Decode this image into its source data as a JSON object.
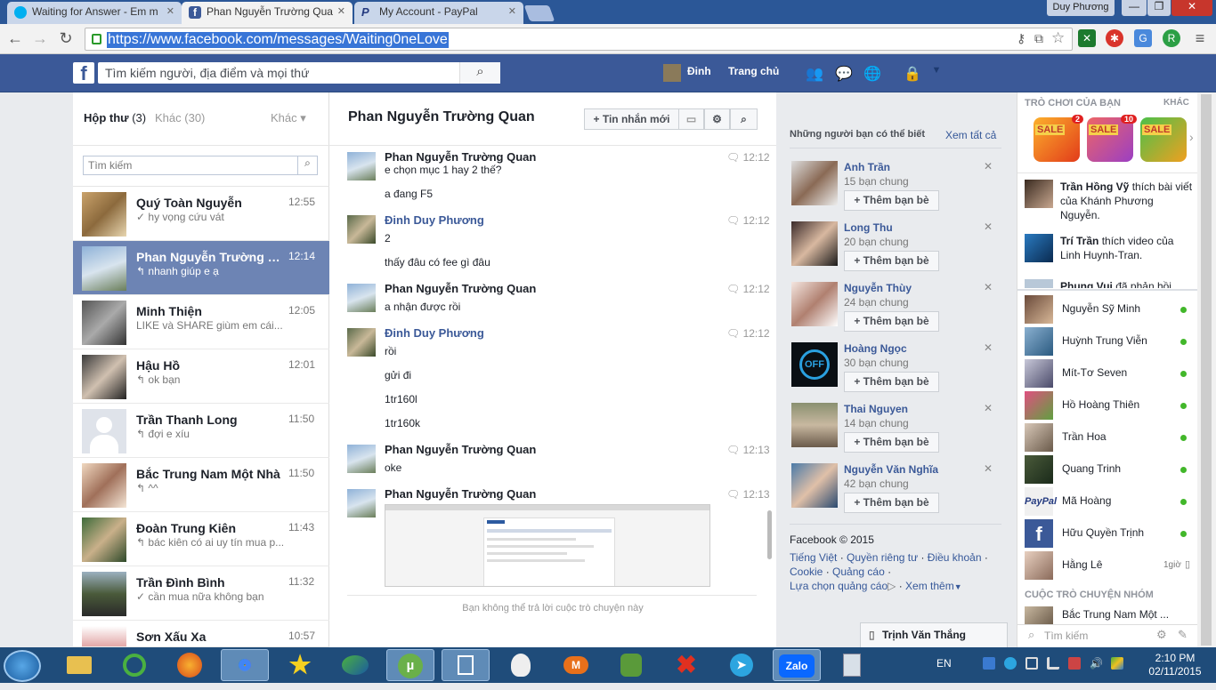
{
  "browser": {
    "tabs": [
      {
        "title": "Waiting for Answer - Em m",
        "icon": "skype-icon"
      },
      {
        "title": "Phan Nguyễn Trường Qua",
        "icon": "facebook-icon"
      },
      {
        "title": "My Account - PayPal",
        "icon": "paypal-icon"
      }
    ],
    "profile_name": "Duy Phương",
    "url": "https://www.facebook.com/messages/Waiting0neLove"
  },
  "fb_header": {
    "search_placeholder": "Tìm kiếm người, địa điểm và mọi thứ",
    "user_name": "Đinh",
    "home_label": "Trang chủ"
  },
  "inbox": {
    "inbox_label": "Hộp thư",
    "inbox_count": "(3)",
    "other_label": "Khác",
    "other_count": "(30)",
    "more_label": "Khác",
    "search_placeholder": "Tìm kiếm",
    "threads": [
      {
        "name": "Quý Toàn Nguyễn",
        "time": "12:55",
        "snippet": "✓ hy vọng cứu vát"
      },
      {
        "name": "Phan Nguyễn Trường Quan",
        "time": "12:14",
        "snippet": "↰ nhanh giúp e ạ"
      },
      {
        "name": "Minh Thiện",
        "time": "12:05",
        "snippet": "LIKE và SHARE giùm em cái..."
      },
      {
        "name": "Hậu Hồ",
        "time": "12:01",
        "snippet": "↰ ok bạn"
      },
      {
        "name": "Trần Thanh Long",
        "time": "11:50",
        "snippet": "↰ đợi e xíu"
      },
      {
        "name": "Bắc Trung Nam Một Nhà",
        "time": "11:50",
        "snippet": "↰ ^^"
      },
      {
        "name": "Đoàn Trung Kiên",
        "time": "11:43",
        "snippet": "↰ bác kiên có ai uy tín mua p..."
      },
      {
        "name": "Trần Đình Bình",
        "time": "11:32",
        "snippet": "✓ cần mua nữa không bạn"
      },
      {
        "name": "Sơn Xấu Xa",
        "time": "10:57",
        "snippet": ""
      }
    ]
  },
  "conversation": {
    "title": "Phan Nguyễn Trường Quan",
    "new_message_label": "Tin nhắn mới",
    "messages": [
      {
        "author": "Phan Nguyễn Trường Quan",
        "time": "12:12",
        "lines": [
          "e chọn mục 1  hay 2 thế?",
          "a đang F5"
        ]
      },
      {
        "author": "Đinh Duy Phương",
        "time": "12:12",
        "lines": [
          "2",
          "thấy đâu có fee gì đâu"
        ]
      },
      {
        "author": "Phan Nguyễn Trường Quan",
        "time": "12:12",
        "lines": [
          "a nhận được rồi"
        ]
      },
      {
        "author": "Đinh Duy Phương",
        "time": "12:12",
        "lines": [
          "rồi",
          "gửi đi",
          "1tr160l",
          "1tr160k"
        ]
      },
      {
        "author": "Phan Nguyễn Trường Quan",
        "time": "12:13",
        "lines": [
          "oke"
        ]
      },
      {
        "author": "Phan Nguyễn Trường Quan",
        "time": "12:13",
        "lines": []
      }
    ],
    "cannot_reply": "Bạn không thể trả lời cuộc trò chuyện này"
  },
  "suggestions": {
    "title": "Những người bạn có thể biết",
    "see_all": "Xem tất cả",
    "add_label": "Thêm bạn bè",
    "people": [
      {
        "name": "Anh Trần",
        "mutual": "15 bạn chung"
      },
      {
        "name": "Long Thu",
        "mutual": "20 bạn chung"
      },
      {
        "name": "Nguyễn Thùy",
        "mutual": "24 bạn chung"
      },
      {
        "name": "Hoàng Ngọc",
        "mutual": "30 bạn chung"
      },
      {
        "name": "Thai Nguyen",
        "mutual": "14 bạn chung"
      },
      {
        "name": "Nguyễn Văn Nghĩa",
        "mutual": "42 bạn chung"
      }
    ],
    "footer": {
      "copyright": "Facebook © 2015",
      "links_1": [
        "Tiếng Việt",
        "Quyền riêng tư",
        "Điều khoản"
      ],
      "links_2": [
        "Cookie",
        "Quảng cáo"
      ],
      "links_3": [
        "Lựa chọn quảng cáo",
        "Xem thêm"
      ]
    }
  },
  "right_sidebar": {
    "games_title": "TRÒ CHƠI CỦA BẠN",
    "games_more": "KHÁC",
    "games": [
      {
        "label": "SALE",
        "badge": "2"
      },
      {
        "label": "SALE",
        "badge": "10"
      },
      {
        "label": "SALE",
        "badge": ""
      }
    ],
    "ticker": [
      {
        "name": "Trần Hồng Vỹ",
        "text": "thích bài viết của Khánh Phương Nguyễn."
      },
      {
        "name": "Trí Trần",
        "text": "thích video của Linh Huynh-Tran."
      },
      {
        "name": "Phung Vui",
        "text": "đã phản hồi"
      }
    ],
    "friends": [
      {
        "name": "Nguyễn Sỹ Minh",
        "status": ""
      },
      {
        "name": "Huỳnh Trung Viễn",
        "status": ""
      },
      {
        "name": "Mít-Tơ Seven",
        "status": ""
      },
      {
        "name": "Hồ Hoàng Thiên",
        "status": ""
      },
      {
        "name": "Trần Hoa",
        "status": ""
      },
      {
        "name": "Quang Trinh",
        "status": ""
      },
      {
        "name": "Mã Hoàng",
        "status": ""
      },
      {
        "name": "Hữu Quyền Trịnh",
        "status": ""
      },
      {
        "name": "Hằng Lê",
        "status": "1giờ"
      }
    ],
    "group_title": "CUỘC TRÒ CHUYỆN NHÓM",
    "group_item": "Bắc Trung Nam Một ...",
    "search_placeholder": "Tìm kiếm"
  },
  "chat_tab": "Trịnh Văn Thắng",
  "taskbar": {
    "lang": "EN",
    "time": "2:10 PM",
    "date": "02/11/2015",
    "apps": [
      "explorer-icon",
      "unikey-icon",
      "firefox-icon",
      "chrome-icon",
      "star-icon",
      "network-icon",
      "utorrent-icon",
      "folder-icon",
      "alien-icon",
      "mega-icon",
      "evernote-icon",
      "teamviewer-icon",
      "telegram-icon",
      "zalo-icon",
      "calculator-icon"
    ],
    "zalo_label": "Zalo",
    "mega_label": "M"
  }
}
